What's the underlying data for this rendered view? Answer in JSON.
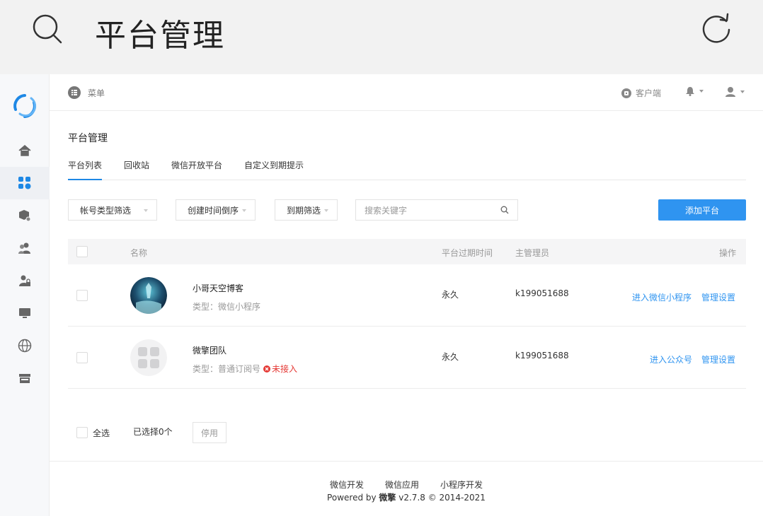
{
  "topbar": {
    "title": "平台管理"
  },
  "header": {
    "menu_label": "菜单",
    "client_label": "客户端"
  },
  "page_title": "平台管理",
  "tabs": [
    {
      "label": "平台列表",
      "active": true
    },
    {
      "label": "回收站",
      "active": false
    },
    {
      "label": "微信开放平台",
      "active": false
    },
    {
      "label": "自定义到期提示",
      "active": false
    }
  ],
  "filters": {
    "account_type": "帐号类型筛选",
    "sort": "创建时间倒序",
    "expire": "到期筛选",
    "search_placeholder": "搜索关键字",
    "add_button": "添加平台"
  },
  "table": {
    "columns": {
      "name": "名称",
      "expire": "平台过期时间",
      "admin": "主管理员",
      "actions": "操作"
    },
    "rows": [
      {
        "name": "小哥天空博客",
        "type": "类型：微信小程序",
        "status_badge": "",
        "expire": "永久",
        "admin": "k199051688",
        "action_enter": "进入微信小程序",
        "action_manage": "管理设置"
      },
      {
        "name": "微擎团队",
        "type": "类型：普通订阅号",
        "status_badge": "未接入",
        "expire": "永久",
        "admin": "k199051688",
        "action_enter": "进入公众号",
        "action_manage": "管理设置"
      }
    ]
  },
  "bottom": {
    "select_all": "全选",
    "selected_count": "已选择0个",
    "disable_button": "停用"
  },
  "footer": {
    "links": [
      "微信开发",
      "微信应用",
      "小程序开发"
    ],
    "powered_prefix": "Powered by ",
    "brand": "微擎",
    "powered_suffix": " v2.7.8 © 2014-2021"
  },
  "colors": {
    "accent": "#2f94f0",
    "danger": "#e53935"
  }
}
